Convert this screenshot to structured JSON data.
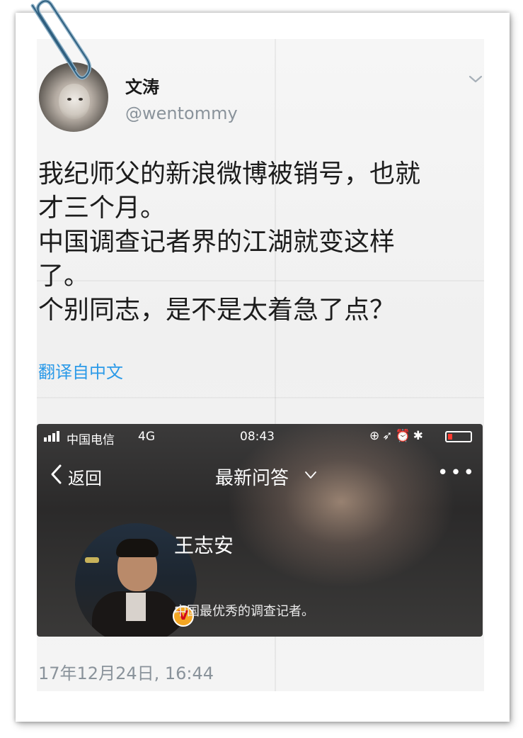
{
  "tweet": {
    "display_name": "文涛",
    "handle": "@wentommy",
    "lines": [
      "我纪师父的新浪微博被销号，也就",
      "才三个月。",
      "中国调查记者界的江湖就变这样",
      "了。",
      "个别同志，是不是太着急了点？"
    ],
    "translate_label": "翻译自中文",
    "timestamp": "17年12月24日, 16:44"
  },
  "embedded_screenshot": {
    "status_bar": {
      "carrier": "中国电信",
      "network": "4G",
      "time": "08:43"
    },
    "nav": {
      "back_label": "返回",
      "title": "最新问答",
      "more": "•••"
    },
    "profile": {
      "name": "王志安",
      "description": "中国最优秀的调查记者。",
      "badge": "V"
    }
  },
  "colors": {
    "link_blue": "#2b9ae8",
    "meta_gray": "#8a939b",
    "badge_orange": "#f4a623"
  }
}
